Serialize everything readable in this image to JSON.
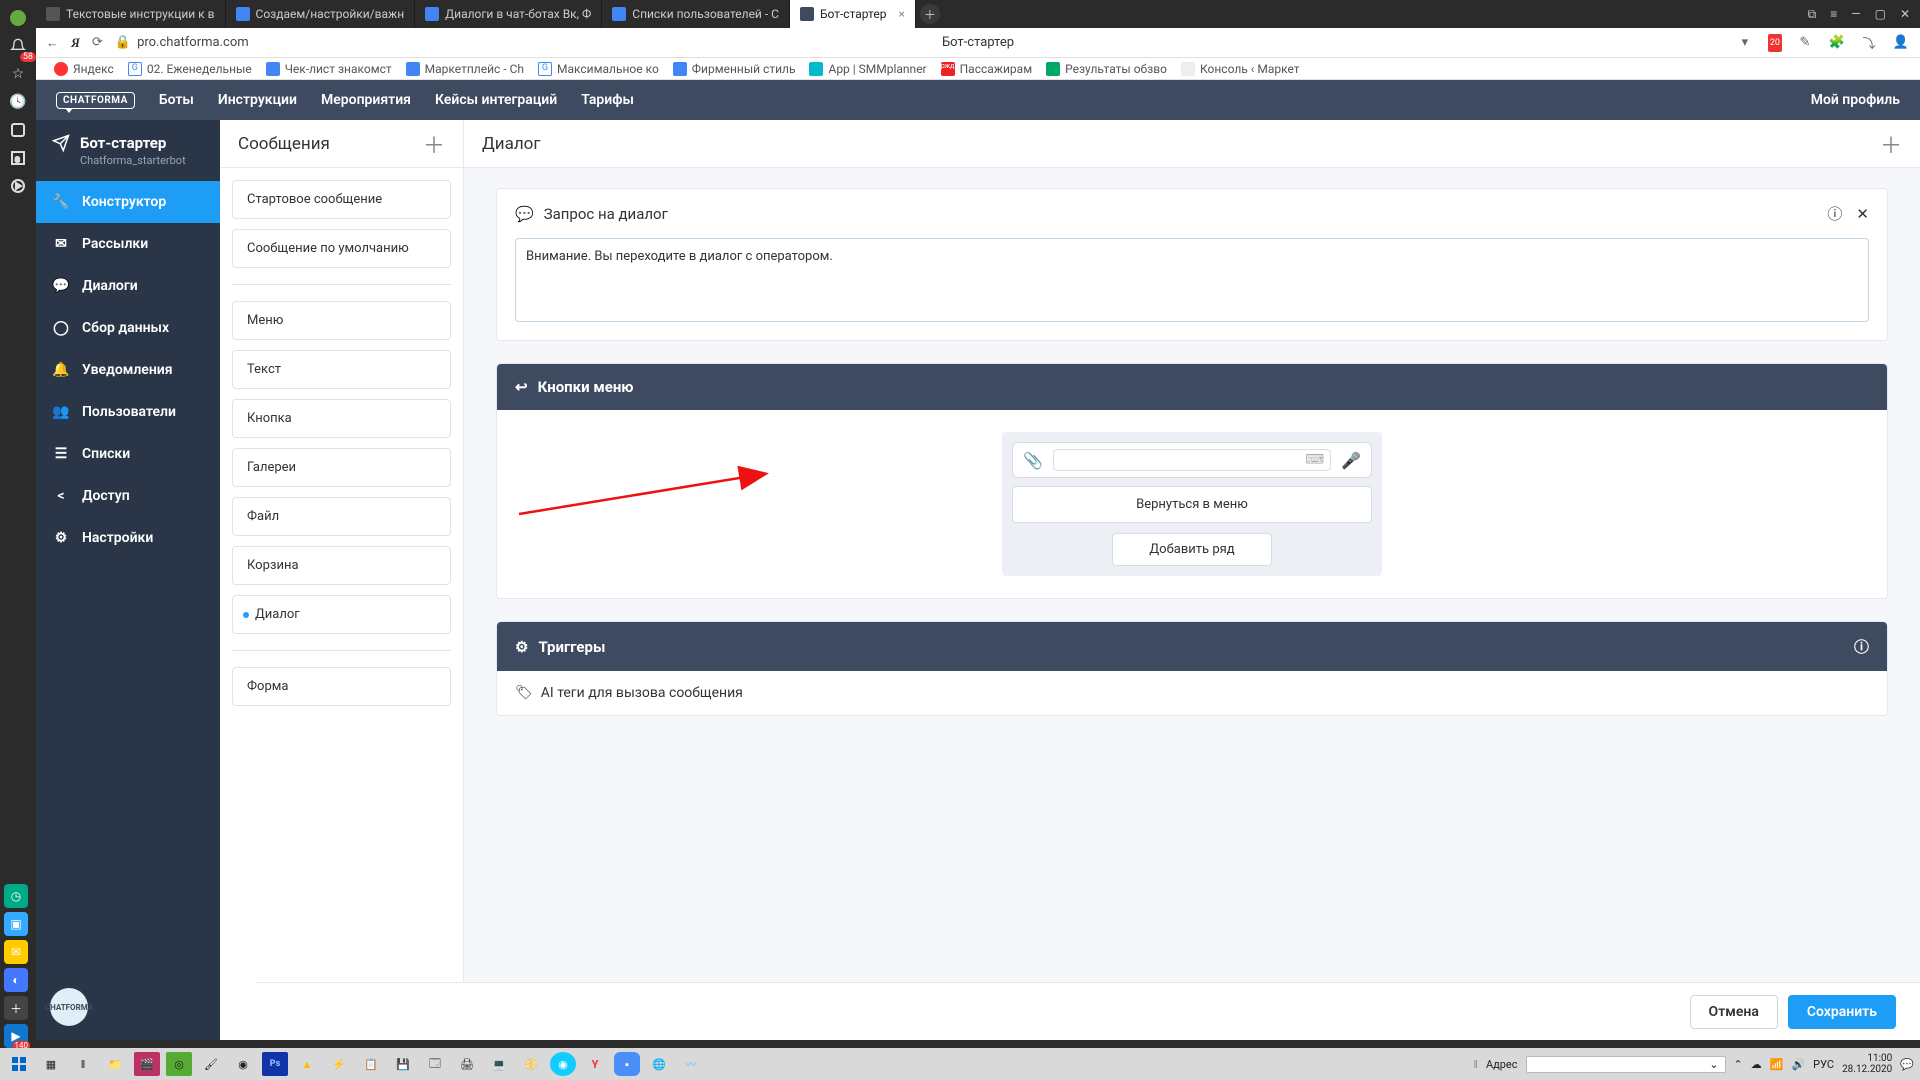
{
  "browser": {
    "tabs": [
      {
        "label": "Текстовые инструкции к в"
      },
      {
        "label": "Создаем/настройки/важн"
      },
      {
        "label": "Диалоги в чат-ботах Вк, Ф"
      },
      {
        "label": "Списки пользователей - С"
      },
      {
        "label": "Бот-стартер"
      }
    ],
    "url": "pro.chatforma.com",
    "page_title": "Бот-стартер",
    "bookmarks": [
      "Яндекс",
      "02. Еженедельные",
      "Чек-лист знакомст",
      "Маркетплейс - Ch",
      "Максимальное ко",
      "Фирменный стиль",
      "App | SMMplanner",
      "Пассажирам",
      "Результаты обзво",
      "Консоль ‹ Маркет"
    ]
  },
  "appnav": {
    "logo": "CHATFORMA",
    "links": [
      "Боты",
      "Инструкции",
      "Мероприятия",
      "Кейсы интеграций",
      "Тарифы"
    ],
    "profile": "Мой профиль"
  },
  "sidebar": {
    "bot": {
      "title": "Бот-стартер",
      "sub": "Chatforma_starterbot"
    },
    "items": [
      {
        "label": "Конструктор"
      },
      {
        "label": "Рассылки"
      },
      {
        "label": "Диалоги"
      },
      {
        "label": "Сбор данных"
      },
      {
        "label": "Уведомления"
      },
      {
        "label": "Пользователи"
      },
      {
        "label": "Списки"
      },
      {
        "label": "Доступ"
      },
      {
        "label": "Настройки"
      }
    ]
  },
  "messages": {
    "header": "Сообщения",
    "items": [
      "Стартовое сообщение",
      "Сообщение по умолчанию",
      "Меню",
      "Текст",
      "Кнопка",
      "Галереи",
      "Файл",
      "Корзина",
      "Диалог",
      "Форма"
    ]
  },
  "dialog": {
    "header": "Диалог",
    "request": {
      "title": "Запрос на диалог",
      "text": "Внимание. Вы переходите в диалог с оператором."
    },
    "menu": {
      "title": "Кнопки меню",
      "button": "Вернуться в меню",
      "add_row": "Добавить ряд"
    },
    "triggers": {
      "title": "Триггеры"
    },
    "ai": {
      "title": "AI теги для вызова сообщения"
    }
  },
  "footer": {
    "cancel": "Отмена",
    "save": "Сохранить"
  },
  "taskbar": {
    "addr_label": "Адрес",
    "lang": "РУС",
    "time": "11:00",
    "date": "28.12.2020"
  }
}
